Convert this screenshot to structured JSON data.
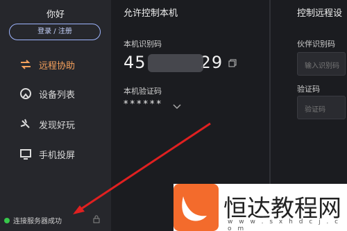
{
  "sidebar": {
    "user_name": "你好",
    "login_label": "登录 / 注册",
    "items": [
      {
        "label": "远程协助",
        "icon": "swap-arrows-icon",
        "active": true
      },
      {
        "label": "设备列表",
        "icon": "device-list-icon",
        "active": false
      },
      {
        "label": "发现好玩",
        "icon": "discover-icon",
        "active": false
      },
      {
        "label": "手机投屏",
        "icon": "screen-cast-icon",
        "active": false
      }
    ],
    "status_text": "连接服务器成功",
    "status_color": "#37c84b"
  },
  "allow_control": {
    "title": "允许控制本机",
    "id_label": "本机识别码",
    "id_prefix": "45",
    "id_suffix": "29",
    "code_label": "本机验证码",
    "code_value": "******"
  },
  "remote_control": {
    "title": "控制远程设",
    "partner_label": "伙伴识别码",
    "partner_placeholder": "输入识别码",
    "code_label": "验证码",
    "code_placeholder": "验证码"
  },
  "watermark": {
    "name": "恒达教程网",
    "url": "w w w . s x h d c j . c o m"
  },
  "accent_color": "#f6a15c"
}
